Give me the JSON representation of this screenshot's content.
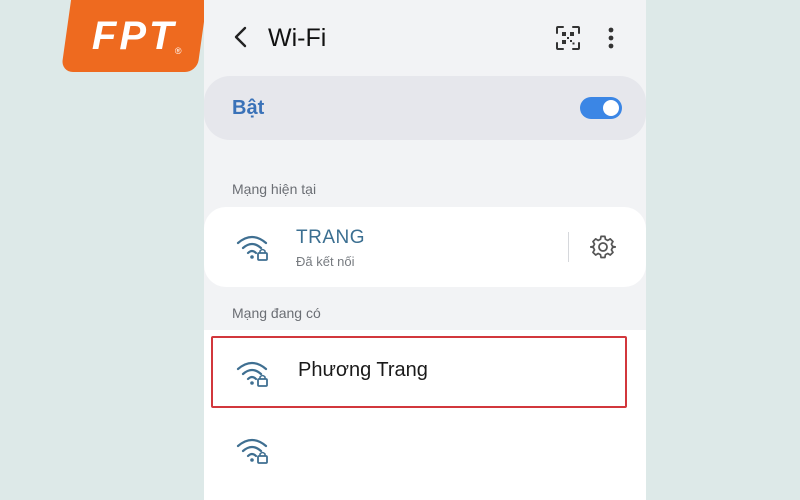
{
  "logo": {
    "text": "FPT",
    "reg_mark": "®"
  },
  "header": {
    "title": "Wi-Fi",
    "back_icon": "chevron-left-icon",
    "qr_icon": "qr-scan-icon",
    "more_icon": "more-vertical-icon"
  },
  "wifi_toggle": {
    "label": "Bật",
    "on": true,
    "accent": "#3b86e5"
  },
  "current_network": {
    "section_label": "Mạng hiện tại",
    "name": "TRANG",
    "status": "Đã kết nối",
    "settings_icon": "gear-icon"
  },
  "available_networks": {
    "section_label": "Mạng đang có",
    "items": [
      {
        "name": "Phương Trang",
        "highlighted": true,
        "highlight_color": "#d2373c"
      },
      {
        "name": ""
      }
    ]
  },
  "colors": {
    "brand": "#ee6a1f",
    "background": "#dde9e8"
  }
}
